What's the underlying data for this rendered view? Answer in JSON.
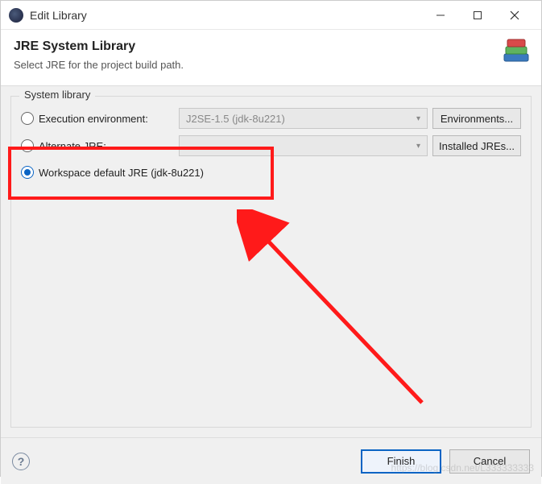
{
  "window": {
    "title": "Edit Library"
  },
  "header": {
    "title": "JRE System Library",
    "subtitle": "Select JRE for the project build path."
  },
  "group": {
    "legend": "System library",
    "exec_env": {
      "label": "Execution environment:",
      "value": "J2SE-1.5 (jdk-8u221)",
      "button": "Environments..."
    },
    "alt_jre": {
      "label": "Alternate JRE:",
      "value": "",
      "button": "Installed JREs..."
    },
    "workspace": {
      "label": "Workspace default JRE (jdk-8u221)"
    }
  },
  "buttons": {
    "finish": "Finish",
    "cancel": "Cancel"
  },
  "watermark": "https://blog.csdn.net/L333333333"
}
